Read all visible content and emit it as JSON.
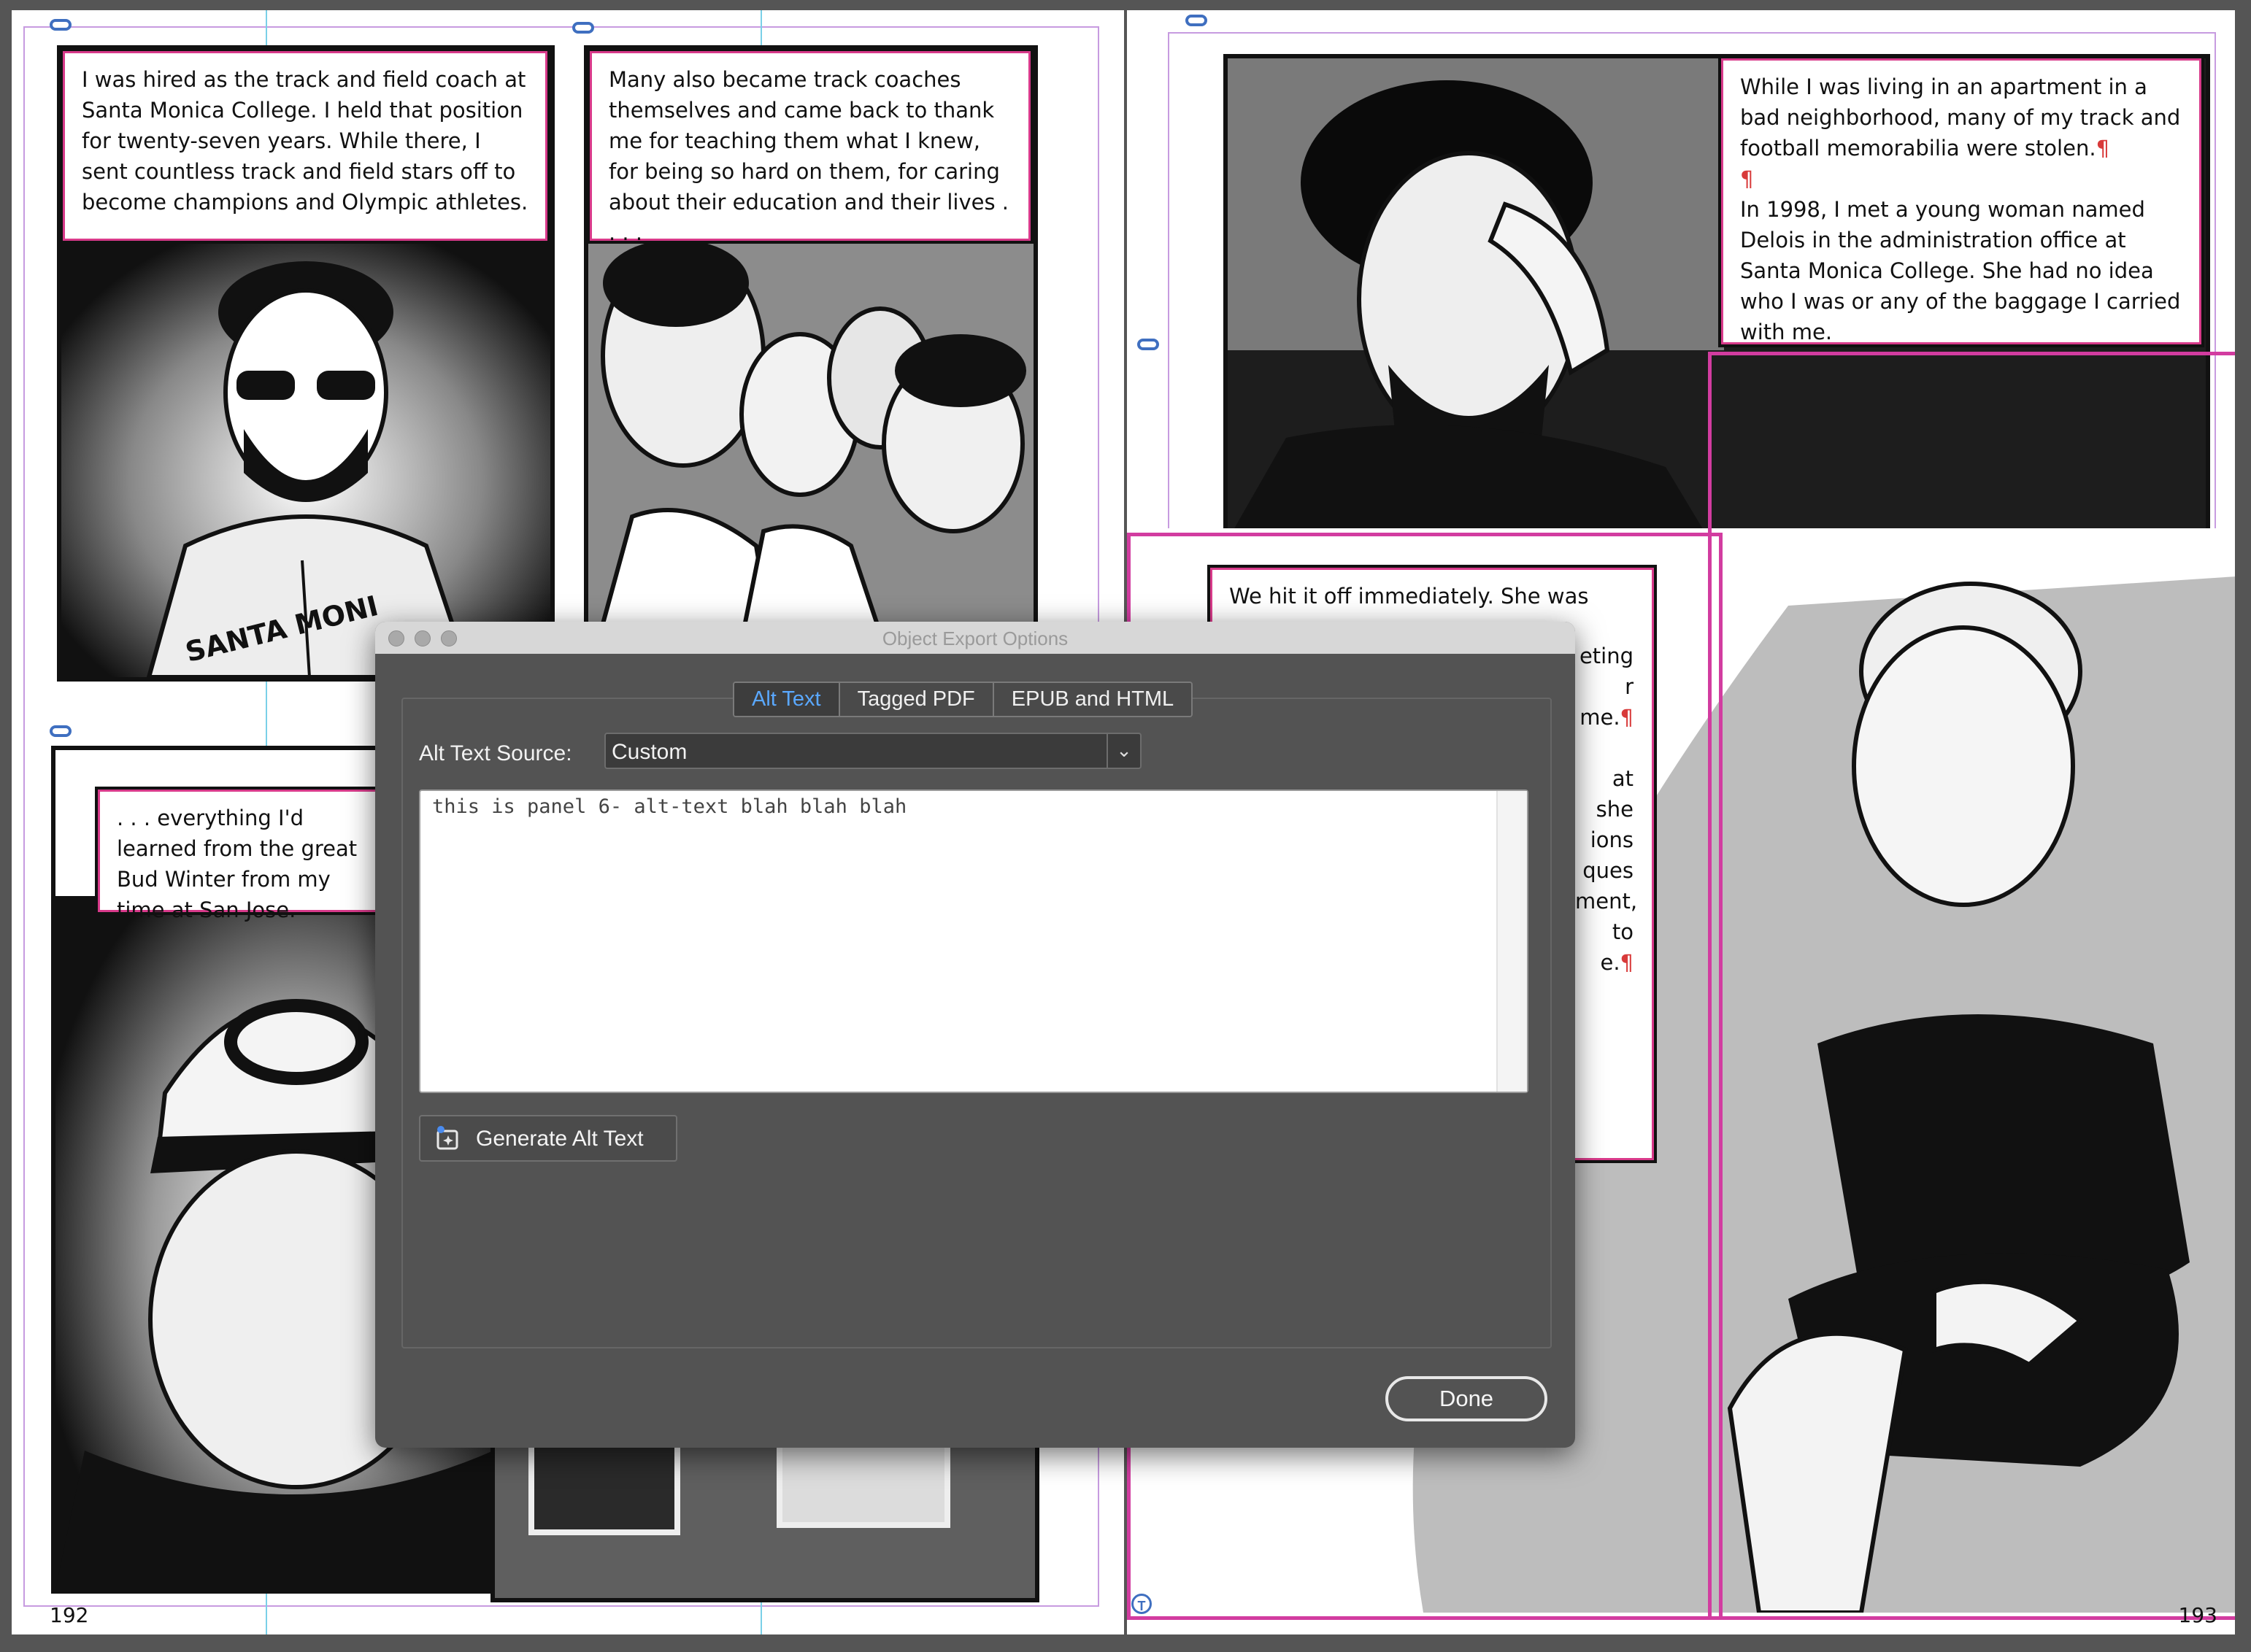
{
  "dialog": {
    "title": "Object Export Options",
    "tabs": [
      {
        "label": "Alt Text",
        "active": true
      },
      {
        "label": "Tagged PDF",
        "active": false
      },
      {
        "label": "EPUB and HTML",
        "active": false
      }
    ],
    "source_label": "Alt Text Source:",
    "source_value": "Custom",
    "alt_text": "this is panel 6- alt-text blah blah blah",
    "generate_label": "Generate Alt Text",
    "done_label": "Done"
  },
  "left_page": {
    "page_number": "192",
    "captions": [
      "I was hired as the track and field coach at Santa Monica College. I held that position for twenty-seven years. While there, I sent countless track and field stars off to become champions and Olympic athletes.",
      "Many also became track coaches themselves and came back to thank me for teaching them what I knew, for being so hard on them, for caring about their education and their lives . . . .",
      ". . . everything I'd learned from the great Bud Winter from my time at San Jose."
    ],
    "hoodie_text": "SANTA MONI"
  },
  "right_page": {
    "page_number": "193",
    "caption_top_1": "While I was living in an apartment in a bad neighborhood, many of my track and football memorabilia were stolen.",
    "caption_top_2": "In 1998, I met a young woman named Delois in the administration office at Santa Monica College. She had no idea who I was or any of the baggage I carried with me.",
    "caption_mid_first": "We hit it off immediately. She was",
    "caption_mid_fragments": [
      "eting",
      "r me.",
      "at she",
      "ions",
      "ques",
      "ment,",
      "to",
      "e."
    ]
  },
  "colors": {
    "dialog_bg": "#535353",
    "active_tab": "#5aa8ff",
    "selection_frame": "#d23ca0",
    "guides": "#7ad0e8",
    "margin_guides": "#c79be0"
  }
}
